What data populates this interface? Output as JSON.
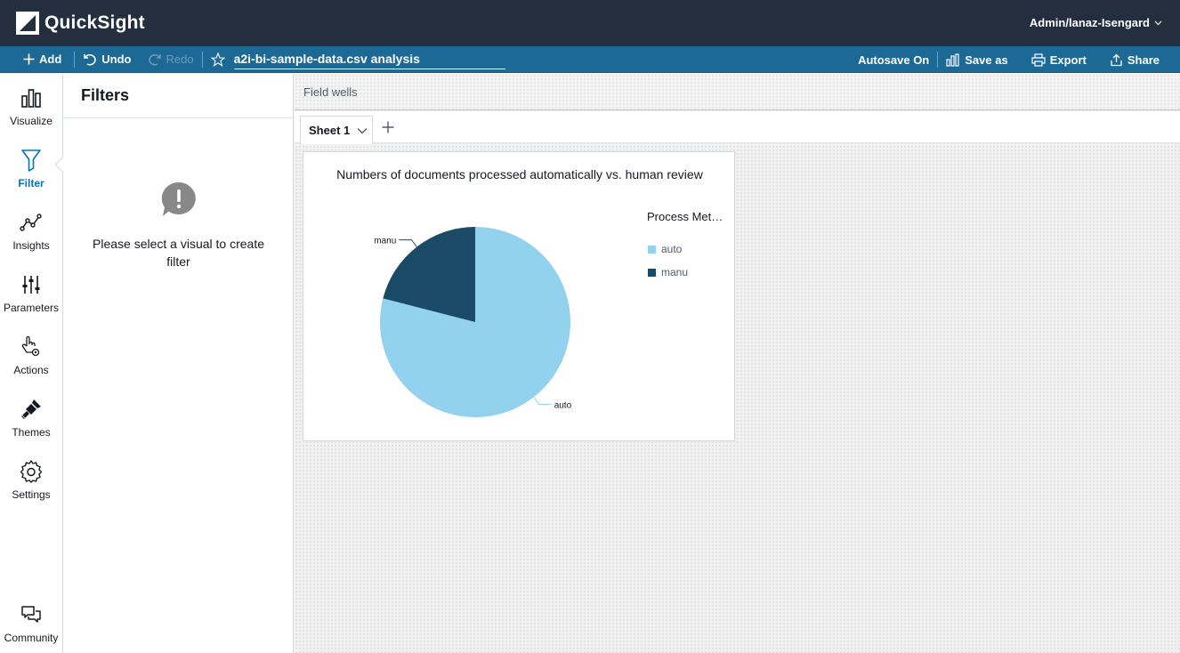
{
  "app": {
    "name": "QuickSight",
    "user": "Admin/lanaz-Isengard"
  },
  "toolbar": {
    "add_label": "Add",
    "undo_label": "Undo",
    "redo_label": "Redo",
    "analysis_title": "a2i-bi-sample-data.csv analysis",
    "autosave_label": "Autosave On",
    "save_as_label": "Save as",
    "export_label": "Export",
    "share_label": "Share"
  },
  "nav": {
    "items": [
      {
        "label": "Visualize",
        "icon": "bar-chart-icon"
      },
      {
        "label": "Filter",
        "icon": "filter-icon",
        "active": true
      },
      {
        "label": "Insights",
        "icon": "insights-icon"
      },
      {
        "label": "Parameters",
        "icon": "parameters-icon"
      },
      {
        "label": "Actions",
        "icon": "actions-icon"
      },
      {
        "label": "Themes",
        "icon": "themes-icon"
      },
      {
        "label": "Settings",
        "icon": "gear-icon"
      }
    ],
    "community_label": "Community"
  },
  "filters": {
    "title": "Filters",
    "empty_message": "Please select a visual to create filter"
  },
  "field_wells": {
    "label": "Field wells"
  },
  "sheets": {
    "tabs": [
      {
        "label": "Sheet 1"
      }
    ]
  },
  "colors": {
    "topbar": "#232f3e",
    "toolbar": "#1d6996",
    "accent": "#0073bb",
    "series_auto": "#93d2ef",
    "series_manu": "#1b4a66"
  },
  "chart_data": {
    "type": "pie",
    "title": "Numbers of documents processed automatically vs. human review",
    "legend_title": "Process Met…",
    "legend_position": "right",
    "categories": [
      "auto",
      "manu"
    ],
    "values": [
      79,
      21
    ],
    "colors": [
      "#93d2ef",
      "#1b4a66"
    ]
  }
}
